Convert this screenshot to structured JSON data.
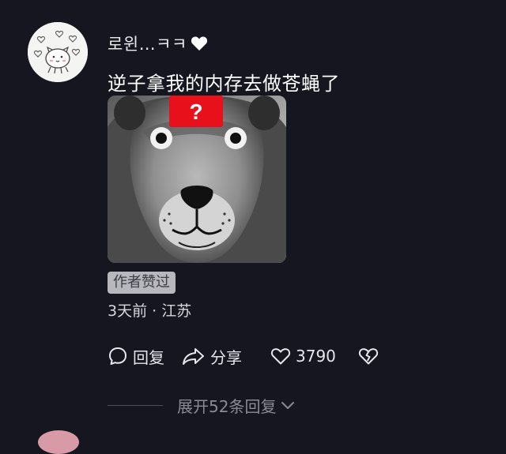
{
  "comment": {
    "username": "로윈…ㅋㅋ",
    "text": "逆子拿我的内存去做苍蝇了",
    "author_liked_badge": "作者赞过",
    "time_location": "3天前 · 江苏",
    "image_overlay_symbol": "?",
    "actions": {
      "reply_label": "回复",
      "share_label": "分享",
      "like_count": "3790"
    },
    "expand_replies_label": "展开52条回复"
  },
  "colors": {
    "background": "#15161f",
    "badge_background": "#b7b7bd",
    "question_box": "#e8101a",
    "muted_text": "#8a8b95"
  },
  "icons": {
    "username_badge": "heart-icon",
    "reply": "comment-bubble-icon",
    "share": "share-arrow-icon",
    "like": "heart-outline-icon",
    "dislike": "broken-heart-icon",
    "expand": "chevron-down-icon"
  }
}
